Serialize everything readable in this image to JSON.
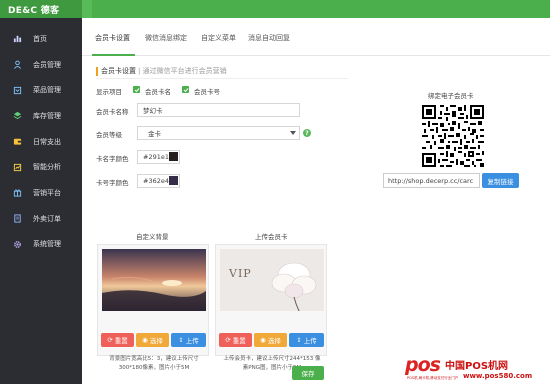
{
  "app": {
    "logo": "DE&C 德客"
  },
  "sidebar": {
    "items": [
      {
        "label": "首页",
        "icon": "bar-chart-icon"
      },
      {
        "label": "会员管理",
        "icon": "user-icon"
      },
      {
        "label": "菜品管理",
        "icon": "book-icon"
      },
      {
        "label": "库存管理",
        "icon": "layers-icon"
      },
      {
        "label": "日常支出",
        "icon": "wallet-icon"
      },
      {
        "label": "智能分析",
        "icon": "analysis-icon"
      },
      {
        "label": "营销平台",
        "icon": "gift-icon"
      },
      {
        "label": "外卖订单",
        "icon": "document-icon"
      },
      {
        "label": "系统管理",
        "icon": "gear-icon"
      }
    ]
  },
  "tabs": [
    {
      "label": "会员卡设置"
    },
    {
      "label": "微信消息绑定"
    },
    {
      "label": "自定义菜单"
    },
    {
      "label": "消息自动回复"
    }
  ],
  "section": {
    "title": "会员卡设置",
    "subtitle": "| 通过微信平台进行会员营销"
  },
  "form": {
    "display_label": "显示项目",
    "check_name": "会员卡名",
    "check_number": "会员卡号",
    "card_name_label": "会员卡名称",
    "card_name_value": "梦幻卡",
    "level_label": "会员等级",
    "level_value": "金卡",
    "name_color_label": "卡名字颜色",
    "name_color_value": "#291e1",
    "name_color_swatch": "#291e1e",
    "number_color_label": "卡号字颜色",
    "number_color_value": "#362e4",
    "number_color_swatch": "#362e48"
  },
  "qr": {
    "title": "绑定电子会员卡",
    "url": "http://shop.decerp.cc/carc",
    "copy_label": "复制链接"
  },
  "custom_bg": {
    "caption": "自定义背景",
    "reset": "重置",
    "select": "选择",
    "upload": "上传",
    "note_line1": "背景图片宽高比5：3，建议上传尺寸",
    "note_line2": "300*180像素，图片小于5M"
  },
  "upload_card": {
    "caption": "上传会员卡",
    "vip_text": "VIP",
    "reset": "重置",
    "select": "选择",
    "upload": "上传",
    "note_line1": "上传会员卡，建议上传尺寸244*153 像",
    "note_line2": "素PNG图，图片小于5M"
  },
  "save_label": "保存",
  "watermark": {
    "pos": "pos",
    "cn": "中国POS机网",
    "url": "www.pos580.com",
    "small": "POS机,刷卡机,移动支付行业门户"
  },
  "colors": {
    "brand_green": "#4bb04b",
    "sidebar_bg": "#2b2d33",
    "blue": "#3a8fe0",
    "red": "#f0605a",
    "orange": "#f0a838"
  }
}
